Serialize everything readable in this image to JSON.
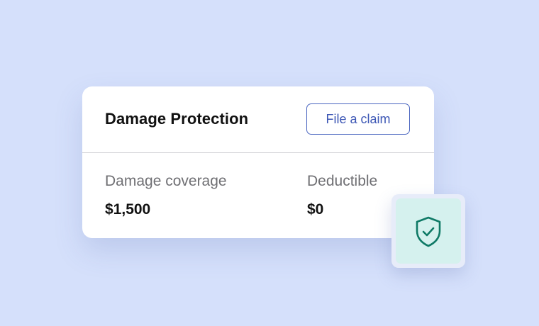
{
  "card": {
    "title": "Damage Protection",
    "claim_button_label": "File a claim",
    "coverage": {
      "label": "Damage coverage",
      "value": "$1,500"
    },
    "deductible": {
      "label": "Deductible",
      "value": "$0"
    }
  },
  "badge": {
    "icon": "shield-check-icon"
  },
  "colors": {
    "background": "#d5e0fb",
    "accent": "#3d57b5",
    "badge_fill": "#d5f1ee",
    "icon_stroke": "#0f7a66"
  }
}
